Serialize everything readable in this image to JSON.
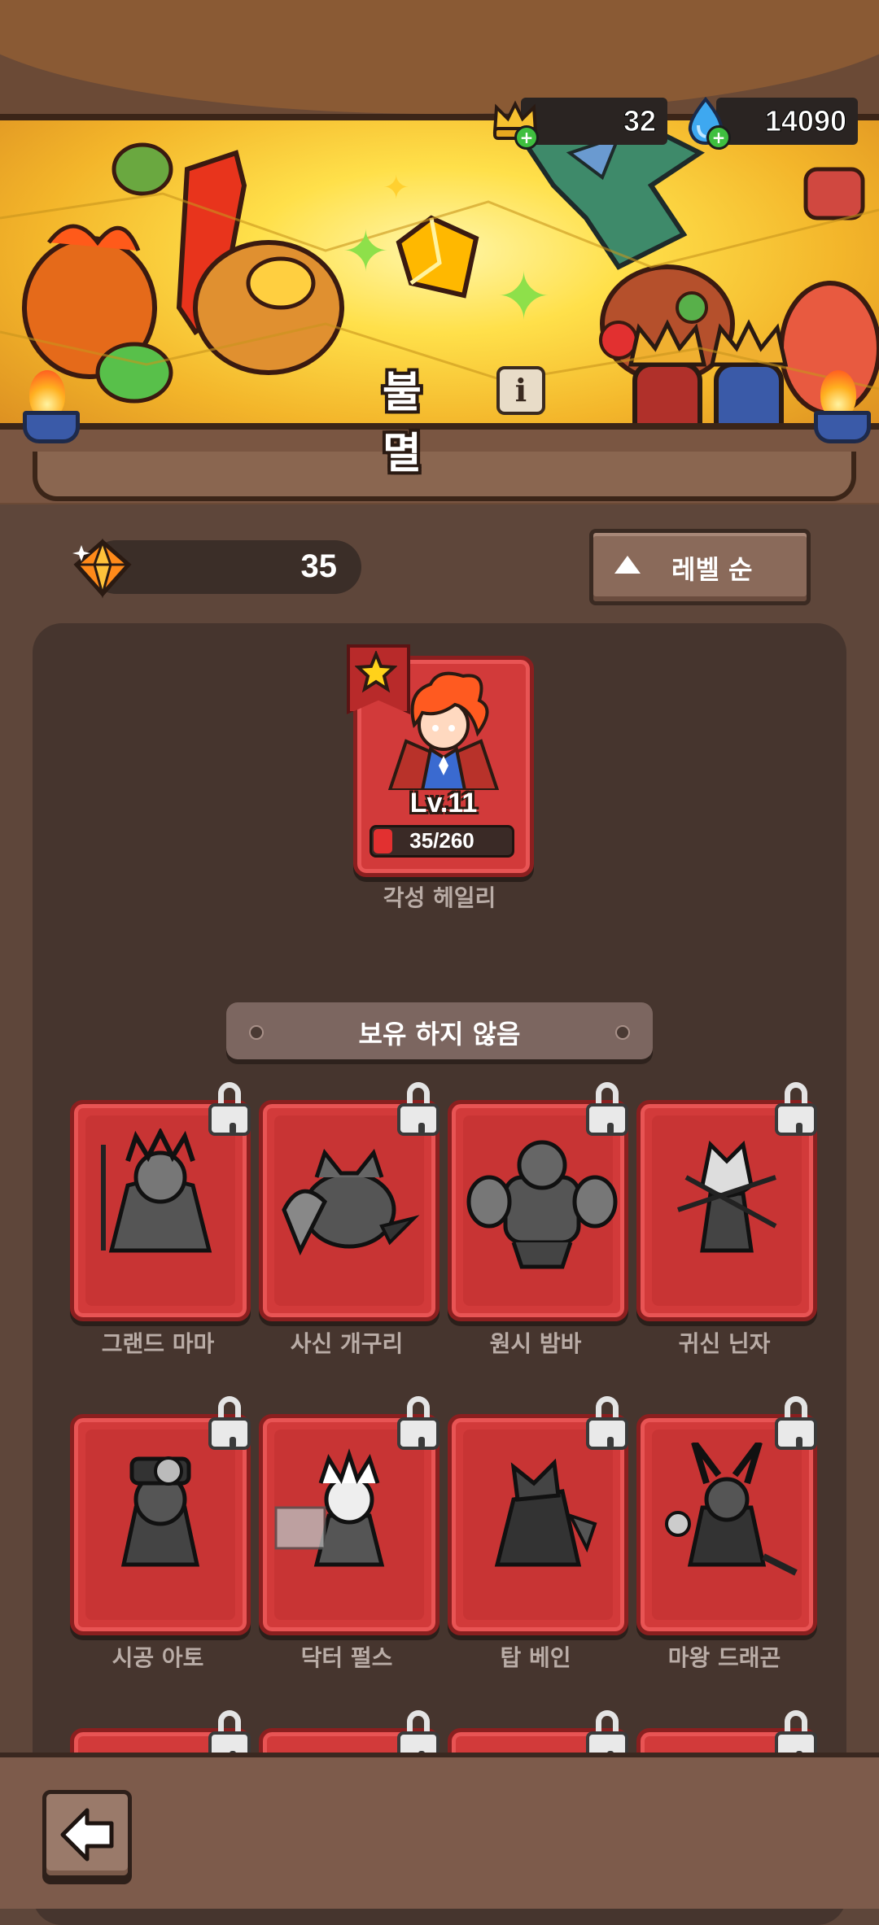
{
  "resources": {
    "crown_count": "32",
    "diamond_count": "14090"
  },
  "banner": {
    "title": "불멸",
    "info_symbol": "i"
  },
  "toolbar": {
    "gem_count": "35",
    "sort_label": "레벨 순"
  },
  "owned": {
    "name": "각성 헤일리",
    "level_label": "Lv.11",
    "progress_text": "35/260",
    "progress_fraction": 0.135
  },
  "section": {
    "not_owned_label": "보유 하지 않음"
  },
  "locked_heroes": [
    {
      "name": "그랜드 마마"
    },
    {
      "name": "사신 개구리"
    },
    {
      "name": "원시 밤바"
    },
    {
      "name": "귀신 닌자"
    },
    {
      "name": "시공 아토"
    },
    {
      "name": "닥터 펄스"
    },
    {
      "name": "탑 베인"
    },
    {
      "name": "마왕 드래곤"
    }
  ],
  "colors": {
    "card_red": "#d23a3a",
    "panel": "#46352e",
    "background": "#5e463a"
  }
}
